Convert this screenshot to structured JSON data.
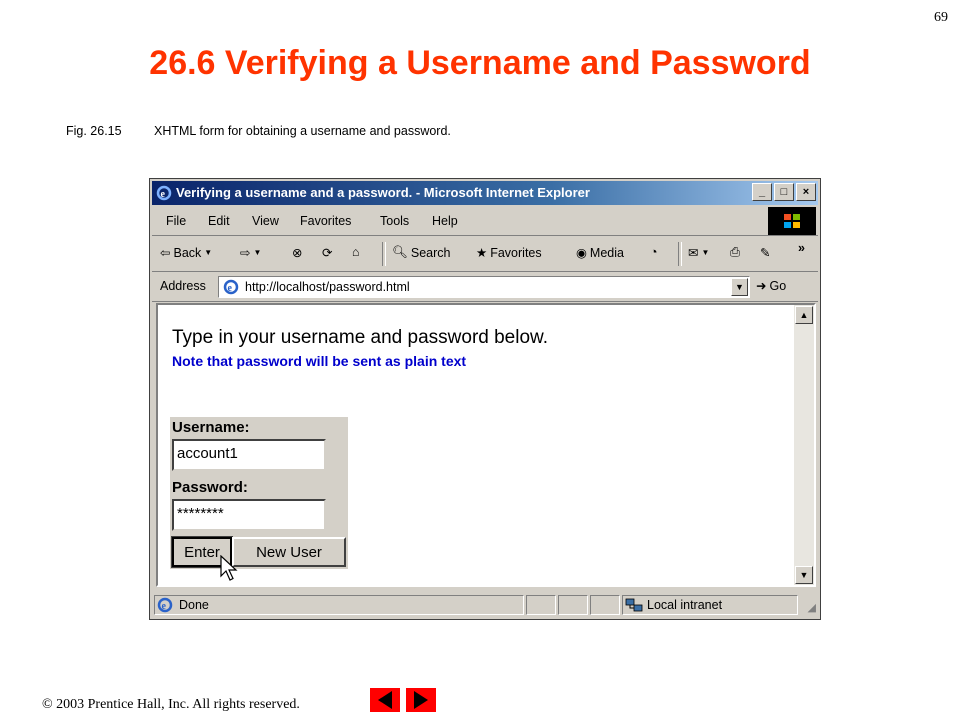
{
  "slide": {
    "number": "69",
    "title": "26.6 Verifying a Username and Password",
    "figure_label": "Fig. 26.15",
    "figure_caption": "XHTML form for obtaining a username and password.",
    "copyright": "© 2003 Prentice Hall, Inc.  All rights reserved."
  },
  "window": {
    "title": "Verifying a username and a password. - Microsoft Internet Explorer",
    "menu": [
      "File",
      "Edit",
      "View",
      "Favorites",
      "Tools",
      "Help"
    ],
    "toolbar": {
      "back": "Back",
      "search": "Search",
      "favorites": "Favorites",
      "media": "Media",
      "more": "»"
    },
    "address_label": "Address",
    "address_value": "http://localhost/password.html",
    "go_label": "Go",
    "status_text": "Done",
    "zone_text": "Local intranet"
  },
  "page": {
    "heading": "Type in your username and password below.",
    "note": "Note that password will be sent as plain text",
    "username_label": "Username:",
    "username_value": "account1",
    "password_label": "Password:",
    "password_value": "********",
    "enter_label": "Enter",
    "newuser_label": "New User"
  },
  "colors": {
    "title": "#ff3300",
    "note": "#0000cc",
    "nav_buttons": "#ff0000",
    "titlebar": "#0a246a"
  }
}
